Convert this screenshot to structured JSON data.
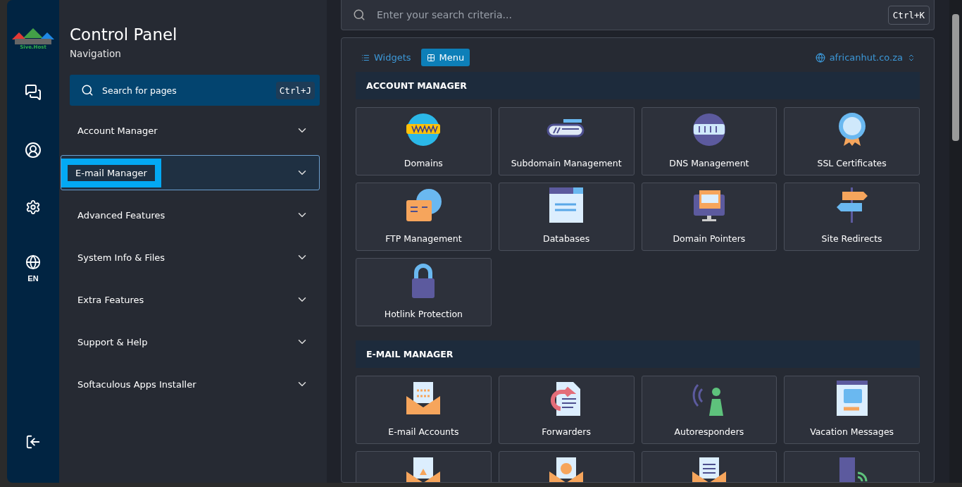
{
  "rail": {
    "logo_text": "Sive.Host",
    "language": "EN"
  },
  "nav": {
    "title": "Control Panel",
    "subtitle": "Navigation",
    "search": {
      "placeholder": "Search for pages",
      "shortcut": "Ctrl+J"
    },
    "items": [
      {
        "label": "Account Manager",
        "selected": false
      },
      {
        "label": "E-mail Manager",
        "selected": true
      },
      {
        "label": "Advanced Features",
        "selected": false
      },
      {
        "label": "System Info & Files",
        "selected": false
      },
      {
        "label": "Extra Features",
        "selected": false
      },
      {
        "label": "Support & Help",
        "selected": false
      },
      {
        "label": "Softaculous Apps Installer",
        "selected": false
      }
    ]
  },
  "top_search": {
    "placeholder": "Enter your search criteria...",
    "shortcut": "Ctrl+K"
  },
  "view_tabs": [
    {
      "label": "Widgets",
      "selected": false
    },
    {
      "label": "Menu",
      "selected": true
    }
  ],
  "domain_selector": "africanhut.co.za",
  "sections": [
    {
      "title": "ACCOUNT MANAGER",
      "tiles": [
        {
          "kind": "labeled",
          "label": "Domains"
        },
        {
          "kind": "labeled",
          "label": "Subdomain Management"
        },
        {
          "kind": "labeled",
          "label": "DNS Management"
        },
        {
          "kind": "labeled",
          "label": "SSL Certificates"
        },
        {
          "kind": "labeled",
          "label": "FTP Management"
        },
        {
          "kind": "labeled",
          "label": "Databases"
        },
        {
          "kind": "labeled",
          "label": "Domain Pointers"
        },
        {
          "kind": "labeled",
          "label": "Site Redirects"
        },
        {
          "kind": "labeled",
          "label": "Hotlink Protection"
        }
      ]
    },
    {
      "title": "E-MAIL MANAGER",
      "tiles": [
        {
          "kind": "labeled",
          "label": "E-mail Accounts"
        },
        {
          "kind": "labeled",
          "label": "Forwarders"
        },
        {
          "kind": "labeled",
          "label": "Autoresponders"
        },
        {
          "kind": "labeled",
          "label": "Vacation Messages"
        },
        {
          "kind": "icon_only"
        },
        {
          "kind": "icon_only"
        },
        {
          "kind": "icon_only"
        },
        {
          "kind": "icon_only"
        }
      ]
    }
  ]
}
